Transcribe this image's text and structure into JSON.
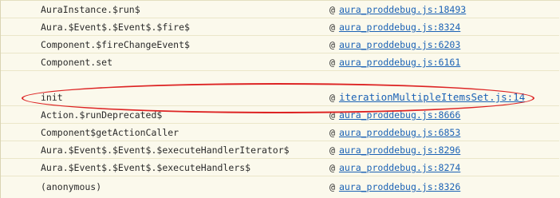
{
  "stack_frames": [
    {
      "fn": "AuraInstance.$run$",
      "at": "@",
      "src": "aura_proddebug.js:18493"
    },
    {
      "fn": "Aura.$Event$.$Event$.$fire$",
      "at": "@",
      "src": "aura_proddebug.js:8324"
    },
    {
      "fn": "Component.$fireChangeEvent$",
      "at": "@",
      "src": "aura_proddebug.js:6203"
    },
    {
      "fn": "Component.set",
      "at": "@",
      "src": "aura_proddebug.js:6161"
    },
    {
      "fn": "init",
      "at": "@",
      "src": "iterationMultipleItemsSet.js:14"
    },
    {
      "fn": "Action.$runDeprecated$",
      "at": "@",
      "src": "aura_proddebug.js:8666"
    },
    {
      "fn": "Component$getActionCaller",
      "at": "@",
      "src": "aura_proddebug.js:6853"
    },
    {
      "fn": "Aura.$Event$.$Event$.$executeHandlerIterator$",
      "at": "@",
      "src": "aura_proddebug.js:8296"
    },
    {
      "fn": "Aura.$Event$.$Event$.$executeHandlers$",
      "at": "@",
      "src": "aura_proddebug.js:8274"
    },
    {
      "fn": "(anonymous)",
      "at": "@",
      "src": "aura_proddebug.js:8326"
    }
  ],
  "highlight": {
    "row_index": 4,
    "color": "#dd2424"
  },
  "colors": {
    "link": "#1b62b5",
    "background": "#fbf9ec"
  }
}
